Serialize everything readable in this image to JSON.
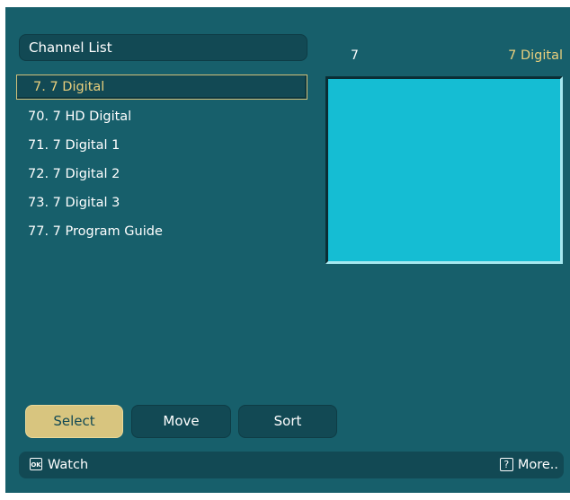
{
  "panel": {
    "title": "Channel List"
  },
  "channels": [
    {
      "label": "7. 7 Digital",
      "selected": true
    },
    {
      "label": "70. 7 HD Digital",
      "selected": false
    },
    {
      "label": "71. 7 Digital 1",
      "selected": false
    },
    {
      "label": "72. 7 Digital 2",
      "selected": false
    },
    {
      "label": "73. 7 Digital 3",
      "selected": false
    },
    {
      "label": "77. 7 Program Guide",
      "selected": false
    }
  ],
  "info": {
    "number": "7",
    "name": "7 Digital"
  },
  "buttons": {
    "select": "Select",
    "move": "Move",
    "sort": "Sort"
  },
  "footer": {
    "ok_icon": "OK",
    "watch": "Watch",
    "help_icon": "?",
    "more": "More.."
  },
  "colors": {
    "background": "#175f6b",
    "panel": "#124954",
    "accent": "#e9cf7d",
    "preview": "#15bdd3"
  }
}
